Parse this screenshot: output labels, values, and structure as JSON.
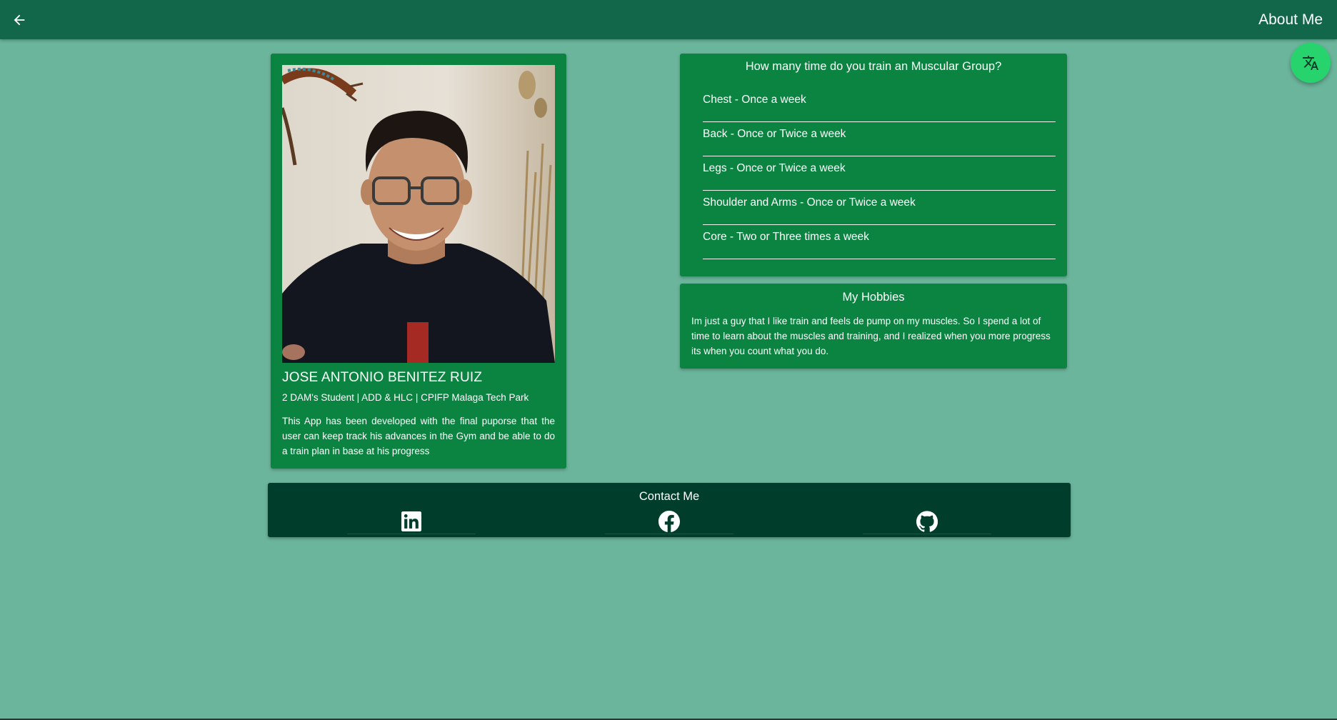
{
  "header": {
    "title": "About Me",
    "back_icon": "arrow-left-icon"
  },
  "fab": {
    "icon": "translate-icon"
  },
  "profile": {
    "name": "JOSE ANTONIO BENITEZ RUIZ",
    "subtitle": "2 DAM's Student | ADD & HLC | CPIFP Malaga Tech Park",
    "description": "This App has been developed with the final puporse that the user can keep track his advances in the Gym and be able to do a train plan in base at his progress"
  },
  "training": {
    "title": "How many time do you train an Muscular Group?",
    "items": [
      "Chest - Once a week",
      "Back - Once or Twice a week",
      "Legs - Once or Twice a week",
      "Shoulder and Arms - Once or Twice a week",
      "Core - Two or Three times a week"
    ]
  },
  "hobbies": {
    "title": "My Hobbies",
    "text": "Im just a guy that I like train and feels de pump on my muscles. So I spend a lot of time to learn about the muscles and training, and I realized when you more progress its when you count what you do."
  },
  "contact": {
    "title": "Contact Me",
    "links": [
      {
        "icon": "linkedin-icon"
      },
      {
        "icon": "facebook-icon"
      },
      {
        "icon": "github-icon"
      }
    ]
  },
  "colors": {
    "background": "#6bb59c",
    "header": "#126649",
    "card": "#0a8440",
    "footer": "#003d2a",
    "fab": "#27d36d"
  }
}
